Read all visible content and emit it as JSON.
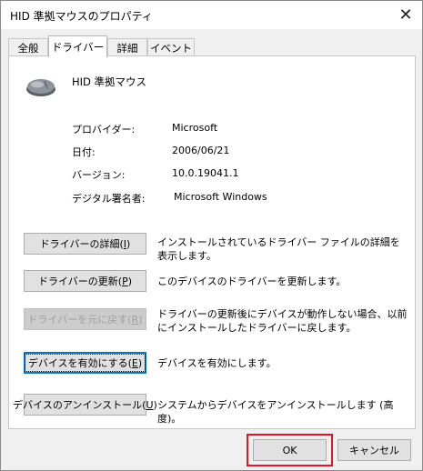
{
  "window": {
    "title": "HID 準拠マウスのプロパティ",
    "close_glyph": "✕"
  },
  "tabs": [
    {
      "label": "全般"
    },
    {
      "label": "ドライバー"
    },
    {
      "label": "詳細"
    },
    {
      "label": "イベント"
    }
  ],
  "device": {
    "name": "HID 準拠マウス",
    "icon": "mouse-icon"
  },
  "info": [
    {
      "label": "プロバイダー:",
      "value": "Microsoft"
    },
    {
      "label": "日付:",
      "value": "2006/06/21"
    },
    {
      "label": "バージョン:",
      "value": "10.0.19041.1"
    },
    {
      "label": "デジタル署名者:",
      "value": "Microsoft Windows"
    }
  ],
  "actions": [
    {
      "label": "ドライバーの詳細(",
      "key": "I",
      "close": ")",
      "desc": "インストールされているドライバー ファイルの詳細を表示します。"
    },
    {
      "label": "ドライバーの更新(",
      "key": "P",
      "close": ")",
      "desc": "このデバイスのドライバーを更新します。"
    },
    {
      "label": "ドライバーを元に戻す(",
      "key": "R",
      "close": ")",
      "desc": "ドライバーの更新後にデバイスが動作しない場合、以前にインストールしたドライバーに戻します。"
    },
    {
      "label": "デバイスを有効にする(",
      "key": "E",
      "close": ")",
      "desc": "デバイスを有効にします。"
    },
    {
      "label": "デバイスのアンインストール(",
      "key": "U",
      "close": ")",
      "desc": "システムからデバイスをアンインストールします (高度)。"
    }
  ],
  "footer": {
    "ok": "OK",
    "cancel": "キャンセル"
  },
  "colors": {
    "highlight": "#e81123",
    "focus": "#0078d7"
  }
}
